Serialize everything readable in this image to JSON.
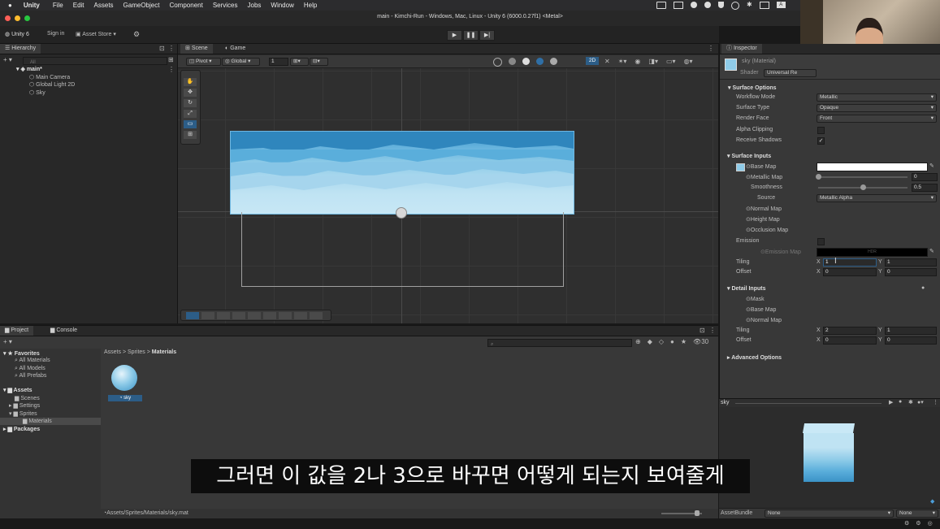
{
  "menubar": {
    "app": "Unity",
    "items": [
      "File",
      "Edit",
      "Assets",
      "GameObject",
      "Component",
      "Services",
      "Jobs",
      "Window",
      "Help"
    ]
  },
  "window": {
    "title": "main - Kimchi-Run - Windows, Mac, Linux - Unity 6 (6000.0.27f1) <Metal>"
  },
  "toolbar": {
    "account": "Unity 6",
    "sign_in": "Sign in",
    "asset_store": "Asset Store"
  },
  "hierarchy": {
    "tab": "Hierarchy",
    "search_placeholder": "All",
    "scene": "main*",
    "items": [
      "Main Camera",
      "Global Light 2D",
      "Sky"
    ]
  },
  "scene_view": {
    "tabs": [
      "Scene",
      "Game"
    ],
    "pivot": "Pivot",
    "global": "Global",
    "snap_value": "1",
    "mode_2d": "2D"
  },
  "inspector": {
    "tab": "Inspector",
    "material_name": "sky (Material)",
    "shader_label": "Shader",
    "shader_value": "Universal Re",
    "surface_options": {
      "header": "Surface Options",
      "rows": [
        {
          "label": "Workflow Mode",
          "value": "Metallic"
        },
        {
          "label": "Surface Type",
          "value": "Opaque"
        },
        {
          "label": "Render Face",
          "value": "Front"
        }
      ],
      "alpha_clipping": "Alpha Clipping",
      "receive_shadows": "Receive Shadows"
    },
    "surface_inputs": {
      "header": "Surface Inputs",
      "base_map": "Base Map",
      "metallic_map": "Metallic Map",
      "metallic_value": "0",
      "smoothness": "Smoothness",
      "smoothness_value": "0.5",
      "source": "Source",
      "source_value": "Metallic Alpha",
      "normal_map": "Normal Map",
      "height_map": "Height Map",
      "occlusion_map": "Occlusion Map",
      "emission": "Emission",
      "emission_map": "Emission Map",
      "emission_value": "HDR",
      "tiling": "Tiling",
      "tiling_x": "1",
      "tiling_y": "1",
      "offset": "Offset",
      "offset_x": "0",
      "offset_y": "0"
    },
    "detail_inputs": {
      "header": "Detail Inputs",
      "mask": "Mask",
      "base_map": "Base Map",
      "normal_map": "Normal Map",
      "tiling": "Tiling",
      "tiling_x": "2",
      "tiling_y": "1",
      "offset": "Offset",
      "offset_x": "0",
      "offset_y": "0"
    },
    "advanced": "Advanced Options",
    "preview_title": "sky",
    "asset_bundle_label": "AssetBundle",
    "asset_bundle_value": "None",
    "asset_bundle_variant": "None"
  },
  "project": {
    "tabs": [
      "Project",
      "Console"
    ],
    "favorites": "Favorites",
    "favorites_items": [
      "All Materials",
      "All Models",
      "All Prefabs"
    ],
    "assets": "Assets",
    "assets_items": [
      "Scenes",
      "Settings",
      "Sprites"
    ],
    "sprites_child": "Materials",
    "packages": "Packages",
    "breadcrumb": [
      "Assets",
      "Sprites",
      "Materials"
    ],
    "asset_name": "sky",
    "status_path": "Assets/Sprites/Materials/sky.mat",
    "count": "30"
  },
  "subtitle": "그러면 이 값을 2나 3으로 바꾸면 어떻게 되는지 보여줄게",
  "colors": {
    "accent_blue": "#2c5d87",
    "sky_light": "#bfe3f3",
    "sky_dark": "#3b93c7"
  }
}
